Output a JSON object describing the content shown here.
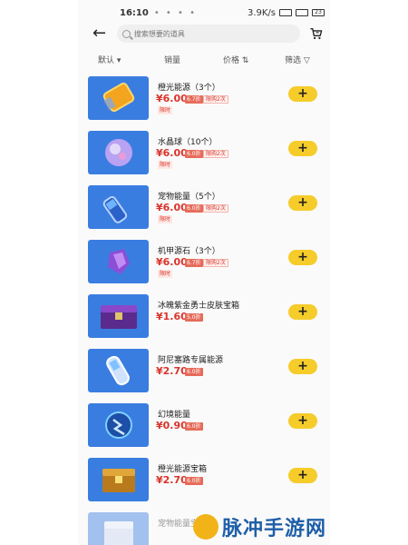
{
  "status_bar": {
    "time": "16:10",
    "dots": "• • • •",
    "speed": "3.9K/s",
    "battery": "23"
  },
  "header": {
    "search_placeholder": "搜索想要的道具"
  },
  "sort_tabs": [
    {
      "label": "默认 ▾"
    },
    {
      "label": "销量"
    },
    {
      "label": "价格 ⇅"
    },
    {
      "label": "筛选 ▽"
    }
  ],
  "products": [
    {
      "name": "橙光能源（3个）",
      "price": "¥6.00",
      "tag1": "6.7折",
      "tag2": "限购2次",
      "sub": "限时",
      "icon": "orange-energy-icon"
    },
    {
      "name": "水晶球（10个）",
      "price": "¥6.00",
      "tag1": "6.0折",
      "tag2": "限购2次",
      "sub": "限时",
      "icon": "crystal-ball-icon"
    },
    {
      "name": "宠物能量（5个）",
      "price": "¥6.00",
      "tag1": "6.0折",
      "tag2": "限购2次",
      "sub": "限时",
      "icon": "pet-energy-icon"
    },
    {
      "name": "机甲源石（3个）",
      "price": "¥6.00",
      "tag1": "6.7折",
      "tag2": "限购2次",
      "sub": "限时",
      "icon": "mecha-stone-icon"
    },
    {
      "name": "冰魄紫金勇士皮肤宝箱",
      "price": "¥1.60",
      "tag1": "5.0折",
      "tag2": "",
      "sub": "",
      "icon": "treasure-chest-icon"
    },
    {
      "name": "阿尼塞路专属能源",
      "price": "¥2.70",
      "tag1": "6.0折",
      "tag2": "",
      "sub": "",
      "icon": "exclusive-energy-icon"
    },
    {
      "name": "幻境能量",
      "price": "¥0.90",
      "tag1": "6.0折",
      "tag2": "",
      "sub": "",
      "icon": "illusion-energy-icon"
    },
    {
      "name": "橙光能源宝箱",
      "price": "¥2.70",
      "tag1": "6.0折",
      "tag2": "",
      "sub": "",
      "icon": "energy-chest-icon"
    },
    {
      "name": "宠物能量宝箱",
      "price": "",
      "tag1": "",
      "tag2": "",
      "sub": "",
      "icon": "pet-energy-chest-icon"
    }
  ],
  "add_label": "+",
  "watermark": {
    "text": "脉冲手游网"
  },
  "colors": {
    "accent": "#f6cc2a",
    "price": "#d9342b",
    "thumb_bg": "#3a7de0",
    "watermark": "#1f5fa8"
  }
}
